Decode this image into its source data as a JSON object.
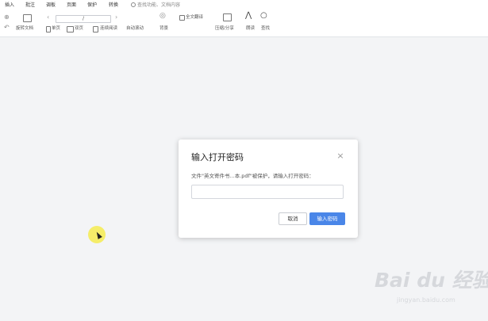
{
  "menu": {
    "items": [
      "插入",
      "批注",
      "调板",
      "页面",
      "保护",
      "转换"
    ],
    "search_label": "查找功能、文档内容"
  },
  "toolbar": {
    "rotate": "旋转文档",
    "single_page": "单页",
    "double_page": "双页",
    "continuous": "连续阅读",
    "auto_scroll": "自动滚动",
    "background": "背景",
    "full_translate": "全文翻译",
    "compress": "压缩/分享",
    "read_aloud": "朗读",
    "find": "查找",
    "page_display": "/"
  },
  "dialog": {
    "title": "输入打开密码",
    "close_glyph": "×",
    "description": "文件\"英文寄件书...本.pdf\"被保护，请输入打开密码：",
    "input_value": "",
    "input_placeholder": "",
    "cancel_label": "取消",
    "confirm_label": "输入密码"
  },
  "watermark": {
    "main": "Bai du 经验",
    "sub": "jingyan.baidu.com"
  },
  "colors": {
    "accent": "#4a86e8",
    "background": "#f3f4f6",
    "cursor_halo": "#f4eb50"
  }
}
